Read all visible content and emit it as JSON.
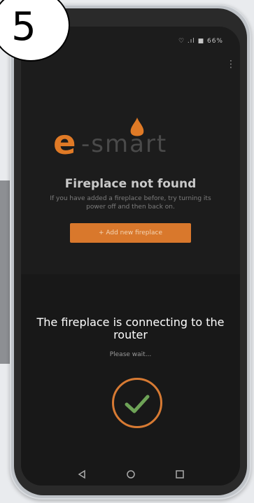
{
  "step": "5",
  "status_bar": {
    "text": "♡ .ıl ■ 66%"
  },
  "logo": {
    "e": "e",
    "rest": "-smart"
  },
  "not_found": {
    "title": "Fireplace not found",
    "subtitle": "If you have added a fireplace before, try turning its power off and then back on.",
    "button": "+ Add new fireplace"
  },
  "connecting": {
    "message": "The fireplace is connecting to the router",
    "please_wait": "Please wait..."
  },
  "colors": {
    "accent": "#d9782c",
    "screen": "#1c1c1c"
  }
}
